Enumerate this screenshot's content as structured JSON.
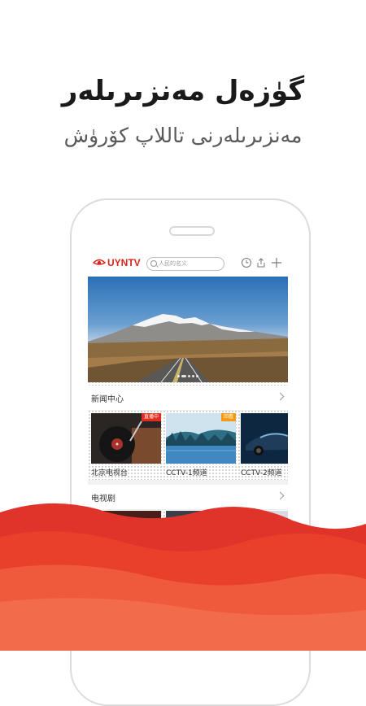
{
  "promo": {
    "headline": "گۈزەل مەنزىرىلەر",
    "subline": "مەنزىرىلەرنى تاللاپ كۆرۈش"
  },
  "app": {
    "logo_text": "UYNTV",
    "search_placeholder": "人民的名义",
    "toolbar_icons": [
      "history-icon",
      "share-icon",
      "add-icon"
    ],
    "banner_dots": 5,
    "active_dot": 1
  },
  "sections": [
    {
      "title": "新闻中心",
      "items": [
        {
          "label": "北京电视台",
          "badge": "直播中",
          "badge_color": "#e02d20"
        },
        {
          "label": "CCTV-1频道",
          "badge": "回看",
          "badge_color": "#f59a12"
        },
        {
          "label": "CCTV-2频道",
          "badge": "",
          "badge_color": ""
        }
      ]
    },
    {
      "title": "电视剧",
      "items": []
    }
  ],
  "colors": {
    "brand_red": "#d7261d",
    "wave_red": "#e8402a"
  }
}
